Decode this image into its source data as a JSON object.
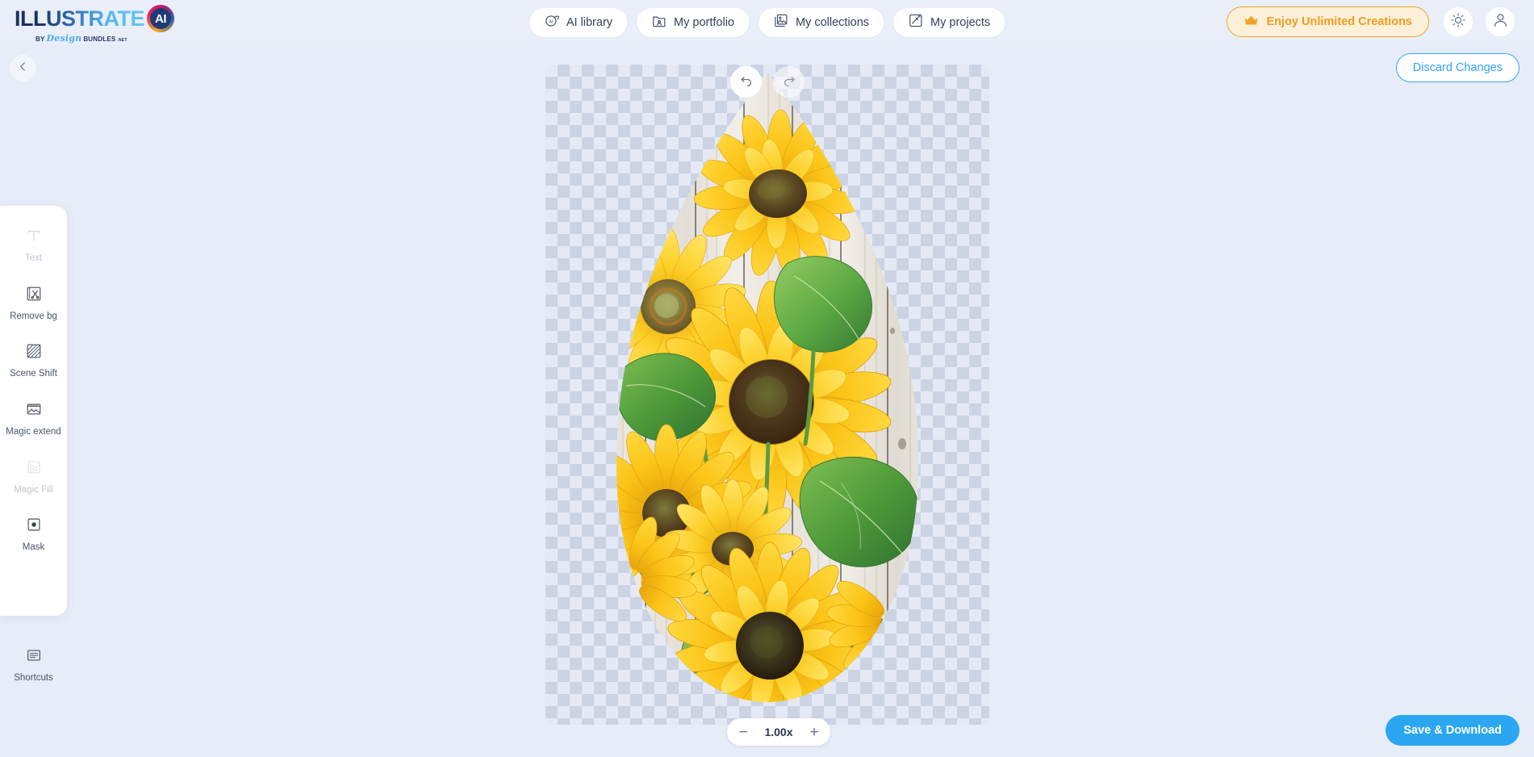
{
  "app": {
    "logo_main": "ILLUSTRATE",
    "logo_badge": "AI",
    "logo_by": "BY",
    "logo_brand_script": "Design",
    "logo_brand_bold": "BUNDLES",
    "logo_brand_tld": ".NET"
  },
  "nav": {
    "items": [
      {
        "label": "AI library",
        "icon": "ai-circle-icon"
      },
      {
        "label": "My portfolio",
        "icon": "portfolio-folder-icon"
      },
      {
        "label": "My collections",
        "icon": "collections-stack-icon"
      },
      {
        "label": "My projects",
        "icon": "magic-wand-icon"
      }
    ],
    "upgrade": {
      "label": "Enjoy Unlimited Creations",
      "icon": "crown-icon"
    },
    "theme_toggle_icon": "sun-icon",
    "account_icon": "user-avatar-icon"
  },
  "header_actions": {
    "back_icon": "chevron-left-icon",
    "discard_label": "Discard Changes"
  },
  "tools": [
    {
      "label": "Text",
      "icon": "text-t-icon",
      "disabled": true
    },
    {
      "label": "Remove bg",
      "icon": "scissors-icon",
      "disabled": false
    },
    {
      "label": "Scene Shift",
      "icon": "hatch-square-icon",
      "disabled": false
    },
    {
      "label": "Magic extend",
      "icon": "expand-image-icon",
      "disabled": false
    },
    {
      "label": "Magic Fill",
      "icon": "fill-pattern-icon",
      "disabled": true
    },
    {
      "label": "Mask",
      "icon": "mask-dot-icon",
      "disabled": false
    }
  ],
  "tools_bottom": {
    "label": "Shortcuts",
    "icon": "keyboard-list-icon"
  },
  "canvas": {
    "undo_icon": "undo-arrow-icon",
    "redo_icon": "redo-arrow-icon",
    "zoom_out_label": "−",
    "zoom_level": "1.00x",
    "zoom_in_label": "+",
    "artwork_description": "Watercolor sunflowers on whitewashed wood planks, masked to a teardrop / egg shape on a transparent checkerboard background"
  },
  "footer_actions": {
    "save_label": "Save & Download"
  },
  "colors": {
    "page_bg": "#e6ecf8",
    "accent_blue": "#2aa7f0",
    "accent_orange": "#ef9d22",
    "panel_white": "#ffffff",
    "checker_light": "#e4e9f5",
    "checker_dark": "#ccd3e3"
  }
}
